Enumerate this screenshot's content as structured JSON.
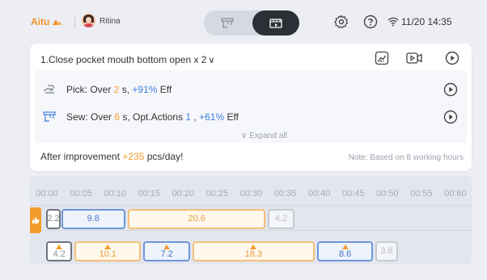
{
  "header": {
    "logo_text": "Aitu",
    "username": "Ritina",
    "datetime": "11/20 14:35",
    "view_toggle": [
      "machine-view",
      "video-view"
    ],
    "icons": [
      "settings-icon",
      "help-icon",
      "wifi-icon"
    ]
  },
  "card": {
    "title": "1.Close pocket mouth bottom open x 2",
    "title_chevron": "✓",
    "actions": [
      {
        "name": "chart-icon"
      },
      {
        "name": "video-icon"
      },
      {
        "name": "play-icon"
      }
    ],
    "rows": [
      {
        "label": "Pick",
        "prefix": "Pick: Over ",
        "value": "2",
        "unit": " s, ",
        "eff": "+91%",
        "eff_suffix": " Eff"
      },
      {
        "label": "Sew",
        "prefix": "Sew: Over ",
        "value": "6",
        "unit": " s, Opt.Actions ",
        "actions_count": "1",
        "sep": " , ",
        "eff": "+61%",
        "eff_suffix": " Eff"
      }
    ],
    "expand_label": "∨  Expand all",
    "after_prefix": "After improvement ",
    "after_value": "+235",
    "after_suffix": " pcs/day!",
    "note": "Note: Based on 8 working hours"
  },
  "timeline": {
    "ticks": [
      "00:00",
      "00:05",
      "00:10",
      "00:15",
      "00:20",
      "00:25",
      "00:30",
      "00:35",
      "00:40",
      "00:45",
      "00:50",
      "00:55",
      "00:60"
    ],
    "lane_a": [
      {
        "value": "2.2",
        "start": 0,
        "dur": 2.2,
        "style": "gray"
      },
      {
        "value": "9.8",
        "start": 2.2,
        "dur": 9.8,
        "style": "blue"
      },
      {
        "value": "20.6",
        "start": 12.0,
        "dur": 20.6,
        "style": "orange"
      },
      {
        "value": "4.2",
        "start": 32.6,
        "dur": 4.2,
        "style": "lightgray"
      }
    ],
    "lane_b": [
      {
        "value": "4.2",
        "start": 0,
        "dur": 4.2,
        "style": "gray",
        "mark": true
      },
      {
        "value": "10.1",
        "start": 4.2,
        "dur": 10.1,
        "style": "orange-dark",
        "mark": true
      },
      {
        "value": "7.2",
        "start": 14.3,
        "dur": 7.2,
        "style": "blue",
        "mark": true
      },
      {
        "value": "18.3",
        "start": 21.5,
        "dur": 18.3,
        "style": "orange-dark",
        "mark": true
      },
      {
        "value": "8.6",
        "start": 39.8,
        "dur": 8.6,
        "style": "blue",
        "mark": true
      },
      {
        "value": "3.6",
        "start": 48.4,
        "dur": 3.6,
        "style": "lightgray",
        "mark": false
      }
    ]
  }
}
